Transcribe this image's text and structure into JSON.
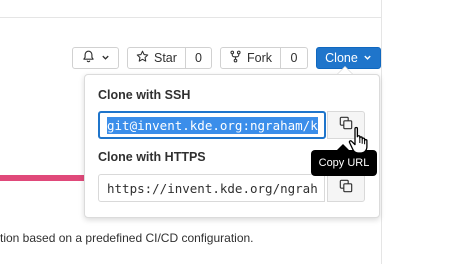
{
  "header": {
    "notification": {
      "icon": "bell-icon",
      "caret": "chevron-down-icon"
    },
    "star": {
      "icon": "star-icon",
      "label": "Star",
      "count": "0"
    },
    "fork": {
      "icon": "fork-icon",
      "label": "Fork",
      "count": "0"
    },
    "clone": {
      "label": "Clone",
      "caret": "chevron-down-icon",
      "color": "#1f75cb"
    }
  },
  "clone_dropdown": {
    "ssh": {
      "title": "Clone with SSH",
      "url": "git@invent.kde.org:ngraham/k",
      "copy_icon": "copy-icon"
    },
    "https": {
      "title": "Clone with HTTPS",
      "url": "https://invent.kde.org/ngrah",
      "copy_icon": "copy-icon"
    },
    "tooltip": "Copy URL"
  },
  "page": {
    "description": "tion based on a predefined CI/CD configuration.",
    "accent_bar_color": "#e0497a"
  }
}
